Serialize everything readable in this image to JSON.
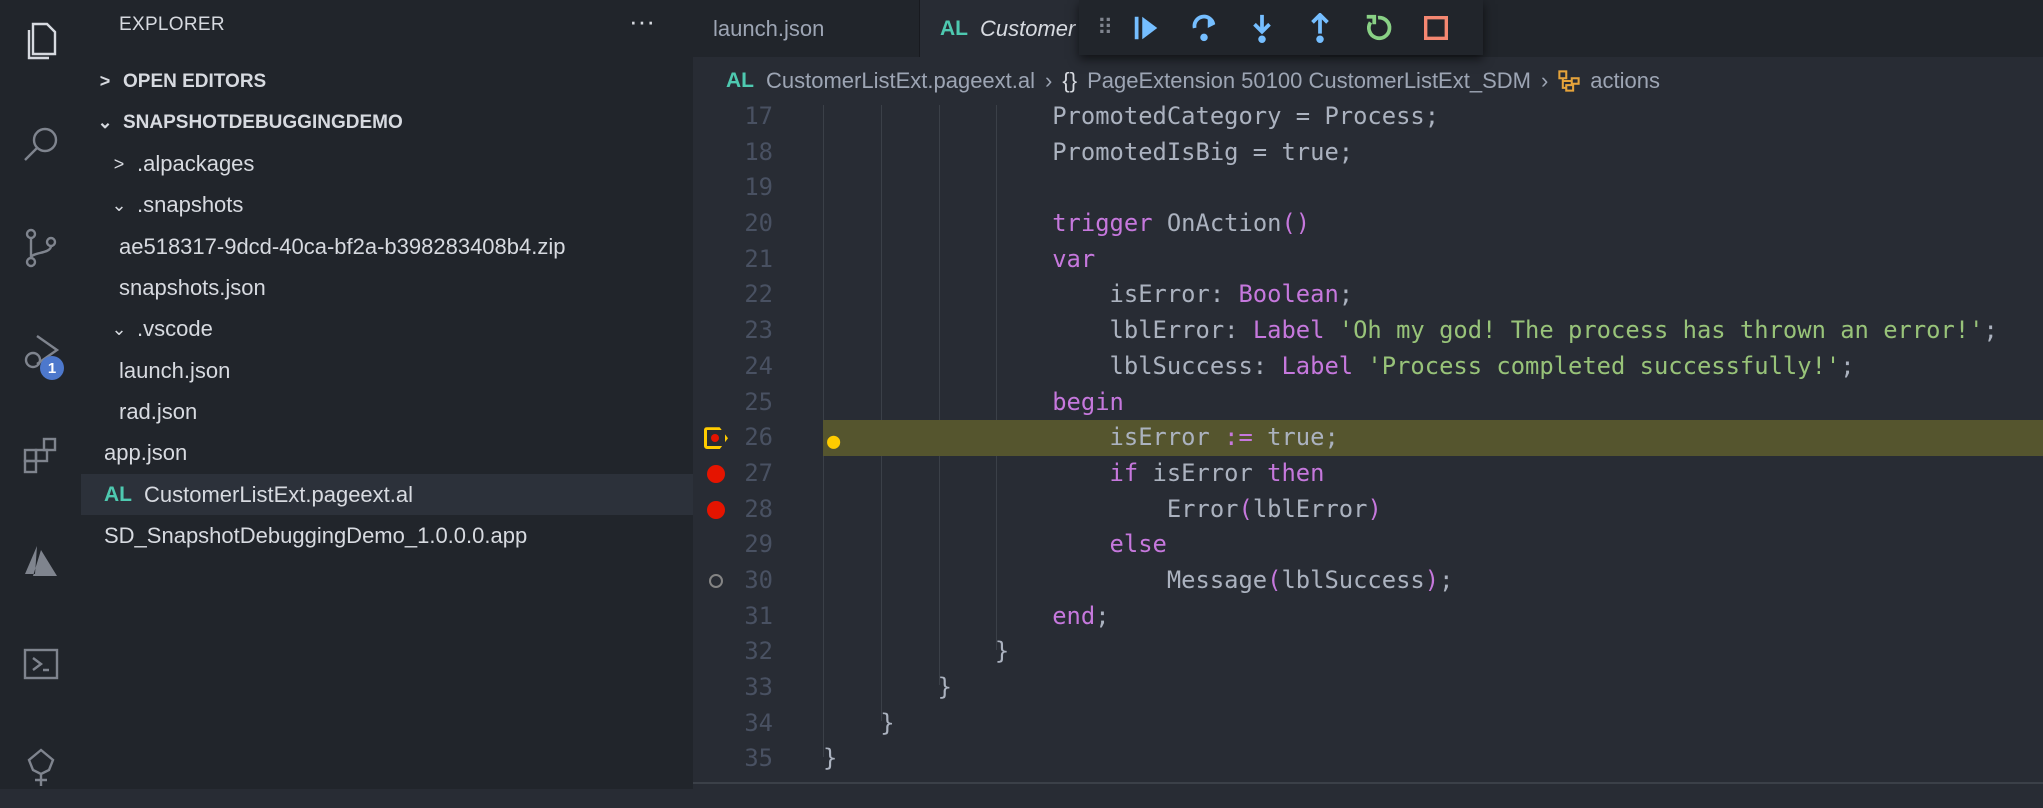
{
  "activity_bar": {
    "items": [
      "files-icon",
      "search-icon",
      "source-control-icon",
      "run-debug-icon",
      "extensions-icon",
      "azure-icon",
      "powershell-icon",
      "tree-icon"
    ],
    "debug_badge": "1"
  },
  "sidebar": {
    "title": "EXPLORER",
    "more": "···",
    "rows": [
      {
        "label": "OPEN EDITORS",
        "chevron": ">",
        "depth": 0,
        "bold": true
      },
      {
        "label": "SNAPSHOTDEBUGGINGDEMO",
        "chevron": "⌄",
        "depth": 0,
        "bold": true
      },
      {
        "label": ".alpackages",
        "chevron": ">",
        "depth": 1
      },
      {
        "label": ".snapshots",
        "chevron": "⌄",
        "depth": 1
      },
      {
        "label": "ae518317-9dcd-40ca-bf2a-b398283408b4.zip",
        "chevron": "",
        "depth": 2
      },
      {
        "label": "snapshots.json",
        "chevron": "",
        "depth": 2
      },
      {
        "label": ".vscode",
        "chevron": "⌄",
        "depth": 1
      },
      {
        "label": "launch.json",
        "chevron": "",
        "depth": 2
      },
      {
        "label": "rad.json",
        "chevron": "",
        "depth": 2
      },
      {
        "label": "app.json",
        "chevron": "",
        "depth": 1
      },
      {
        "label": "CustomerListExt.pageext.al",
        "chevron": "",
        "depth": 1,
        "al": "AL",
        "selected": true
      },
      {
        "label": "SD_SnapshotDebuggingDemo_1.0.0.0.app",
        "chevron": "",
        "depth": 1
      }
    ]
  },
  "tabs": [
    {
      "label": "launch.json"
    },
    {
      "label": "Customer",
      "prefix": "AL",
      "active": true
    }
  ],
  "debug_toolbar": {
    "buttons": [
      "continue",
      "step-over",
      "step-into",
      "step-out",
      "restart",
      "stop"
    ],
    "colors": {
      "blue": "#75beff",
      "green": "#89d185",
      "red": "#f48771"
    }
  },
  "breadcrumb": {
    "prefix": "AL",
    "file": "CustomerListExt.pageext.al",
    "symbol": "PageExtension 50100 CustomerListExt_SDM",
    "member": "actions",
    "braces": "{}"
  },
  "code": {
    "current_line": 26,
    "lines": [
      {
        "n": "17",
        "t": [
          [
            "                PromotedCategory = Process;",
            "pln"
          ]
        ]
      },
      {
        "n": "18",
        "t": [
          [
            "                PromotedIsBig = true;",
            "pln"
          ]
        ]
      },
      {
        "n": "19",
        "t": []
      },
      {
        "n": "20",
        "t": [
          [
            "                trigger",
            "kw"
          ],
          [
            " OnAction",
            "pln"
          ],
          [
            "()",
            "par"
          ]
        ]
      },
      {
        "n": "21",
        "t": [
          [
            "                var",
            "kw"
          ]
        ]
      },
      {
        "n": "22",
        "t": [
          [
            "                    isError: ",
            "pln"
          ],
          [
            "Boolean",
            "typ"
          ],
          [
            ";",
            "pln"
          ]
        ]
      },
      {
        "n": "23",
        "t": [
          [
            "                    lblError: ",
            "pln"
          ],
          [
            "Label",
            "typ"
          ],
          [
            " 'Oh my god! The process has thrown an error!'",
            "str"
          ],
          [
            ";",
            "pln"
          ]
        ]
      },
      {
        "n": "24",
        "t": [
          [
            "                    lblSuccess: ",
            "pln"
          ],
          [
            "Label",
            "typ"
          ],
          [
            " 'Process completed successfully!'",
            "str"
          ],
          [
            ";",
            "pln"
          ]
        ]
      },
      {
        "n": "25",
        "t": [
          [
            "                begin",
            "kw"
          ]
        ]
      },
      {
        "n": "26",
        "t": [
          [
            "                    isError ",
            "pln"
          ],
          [
            ":=",
            "kw"
          ],
          [
            " true;",
            "pln"
          ]
        ],
        "glyph": "current-breakpoint",
        "bulb": true
      },
      {
        "n": "27",
        "t": [
          [
            "                    if",
            "kw"
          ],
          [
            " isError ",
            "pln"
          ],
          [
            "then",
            "kw"
          ]
        ],
        "glyph": "breakpoint"
      },
      {
        "n": "28",
        "t": [
          [
            "                        Error",
            "pln"
          ],
          [
            "(",
            "par"
          ],
          [
            "lblError",
            "pln"
          ],
          [
            ")",
            "par"
          ]
        ],
        "glyph": "breakpoint"
      },
      {
        "n": "29",
        "t": [
          [
            "                    else",
            "kw"
          ]
        ]
      },
      {
        "n": "30",
        "t": [
          [
            "                        Message",
            "pln"
          ],
          [
            "(",
            "par"
          ],
          [
            "lblSuccess",
            "pln"
          ],
          [
            ")",
            "par"
          ],
          [
            ";",
            "pln"
          ]
        ],
        "glyph": "unverified-breakpoint"
      },
      {
        "n": "31",
        "t": [
          [
            "                end",
            "kw"
          ],
          [
            ";",
            "pln"
          ]
        ]
      },
      {
        "n": "32",
        "t": [
          [
            "            }",
            "pln"
          ]
        ]
      },
      {
        "n": "33",
        "t": [
          [
            "        }",
            "pln"
          ]
        ]
      },
      {
        "n": "34",
        "t": [
          [
            "    }",
            "pln"
          ]
        ]
      },
      {
        "n": "35",
        "t": [
          [
            "}",
            "pln"
          ]
        ]
      }
    ]
  }
}
